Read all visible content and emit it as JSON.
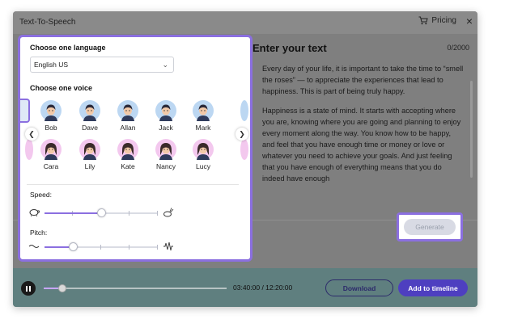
{
  "window": {
    "title": "Text-To-Speech",
    "pricing_label": "Pricing",
    "close_label": "×"
  },
  "language": {
    "label": "Choose one language",
    "selected": "English US"
  },
  "voices": {
    "label": "Choose one voice",
    "row1": [
      "Bob",
      "Dave",
      "Allan",
      "Jack",
      "Mark"
    ],
    "row2": [
      "Cara",
      "Lily",
      "Kate",
      "Nancy",
      "Lucy"
    ]
  },
  "speed": {
    "label": "Speed:",
    "level": 0.5
  },
  "pitch": {
    "label": "Pitch:",
    "level": 0.25
  },
  "text": {
    "heading": "Enter your text",
    "char_count": "0/2000",
    "paragraph1": "Every day of your life, it is important to take the time to “smell the roses” — to appreciate the experiences that lead to happiness. This is part of being truly happy.",
    "paragraph2": "Happiness is a state of mind. It starts with accepting where you are, knowing where you are going and planning to enjoy every moment along the way. You know how to be happy, and feel that you have enough time or money or love or whatever you need to achieve your goals. And just feeling that you have enough of everything means that you do indeed have enough"
  },
  "generate_label": "Generate",
  "footer": {
    "time": "03:40:00 / 12:20:00",
    "download_label": "Download",
    "add_label": "Add to timeline",
    "progress": 0.1
  },
  "colors": {
    "accent": "#8b6fe0",
    "primary_button": "#4e3fc0",
    "male_avatar_bg": "#bcd7f2",
    "female_avatar_bg": "#f3c8ee"
  }
}
